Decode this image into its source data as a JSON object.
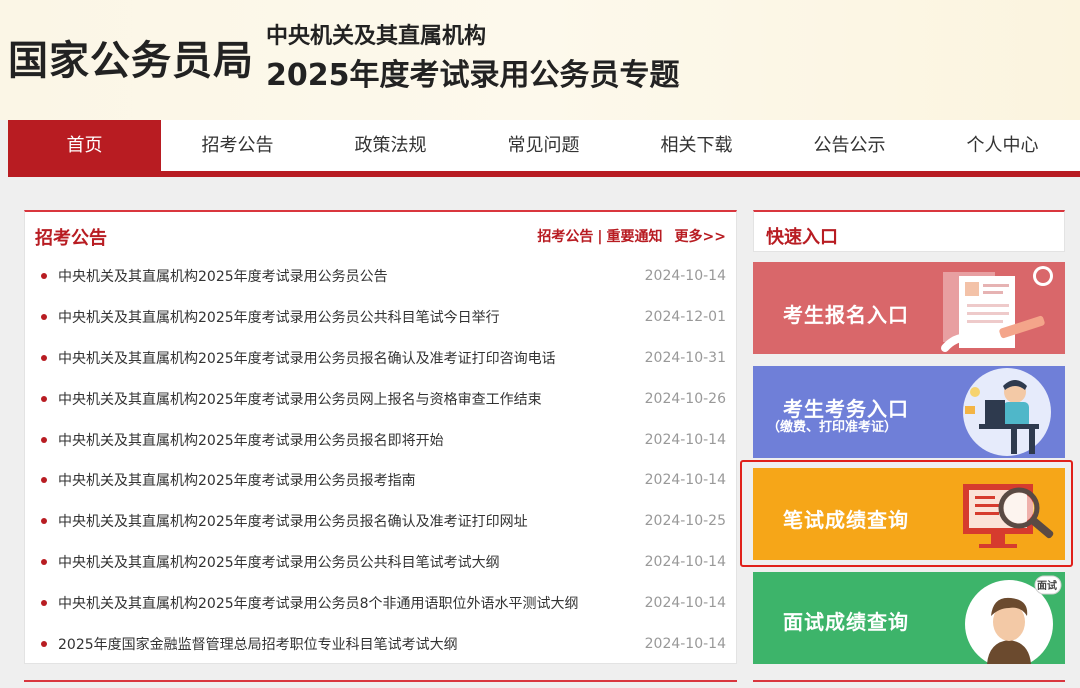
{
  "header": {
    "org_name": "国家公务员局",
    "subtitle_line1": "中央机关及其直属机构",
    "subtitle_line2": "2025年度考试录用公务员专题"
  },
  "nav": {
    "items": [
      {
        "label": "首页",
        "active": true
      },
      {
        "label": "招考公告",
        "active": false
      },
      {
        "label": "政策法规",
        "active": false
      },
      {
        "label": "常见问题",
        "active": false
      },
      {
        "label": "相关下载",
        "active": false
      },
      {
        "label": "公告公示",
        "active": false
      },
      {
        "label": "个人中心",
        "active": false
      }
    ]
  },
  "announcements": {
    "title": "招考公告",
    "link1": "招考公告",
    "separator": "|",
    "link2": "重要通知",
    "more": "更多>>",
    "items": [
      {
        "title": "中央机关及其直属机构2025年度考试录用公务员公告",
        "date": "2024-10-14"
      },
      {
        "title": "中央机关及其直属机构2025年度考试录用公务员公共科目笔试今日举行",
        "date": "2024-12-01"
      },
      {
        "title": "中央机关及其直属机构2025年度考试录用公务员报名确认及准考证打印咨询电话",
        "date": "2024-10-31"
      },
      {
        "title": "中央机关及其直属机构2025年度考试录用公务员网上报名与资格审查工作结束",
        "date": "2024-10-26"
      },
      {
        "title": "中央机关及其直属机构2025年度考试录用公务员报名即将开始",
        "date": "2024-10-14"
      },
      {
        "title": "中央机关及其直属机构2025年度考试录用公务员报考指南",
        "date": "2024-10-14"
      },
      {
        "title": "中央机关及其直属机构2025年度考试录用公务员报名确认及准考证打印网址",
        "date": "2024-10-25"
      },
      {
        "title": "中央机关及其直属机构2025年度考试录用公务员公共科目笔试考试大纲",
        "date": "2024-10-14"
      },
      {
        "title": "中央机关及其直属机构2025年度考试录用公务员8个非通用语职位外语水平测试大纲",
        "date": "2024-10-14"
      },
      {
        "title": "2025年度国家金融监督管理总局招考职位专业科目笔试考试大纲",
        "date": "2024-10-14"
      }
    ]
  },
  "quick_entry": {
    "title": "快速入口",
    "registration": "考生报名入口",
    "affairs": "考生考务入口",
    "affairs_sub": "（缴费、打印准考证）",
    "written_score": "笔试成绩查询",
    "interview_score": "面试成绩查询",
    "interview_badge": "面试"
  },
  "colors": {
    "brand_red": "#b81c22",
    "registration_bg": "#d9676a",
    "affairs_bg": "#6f7fd8",
    "written_bg": "#f6a618",
    "interview_bg": "#3db46a",
    "highlight_border": "#e0201a"
  }
}
